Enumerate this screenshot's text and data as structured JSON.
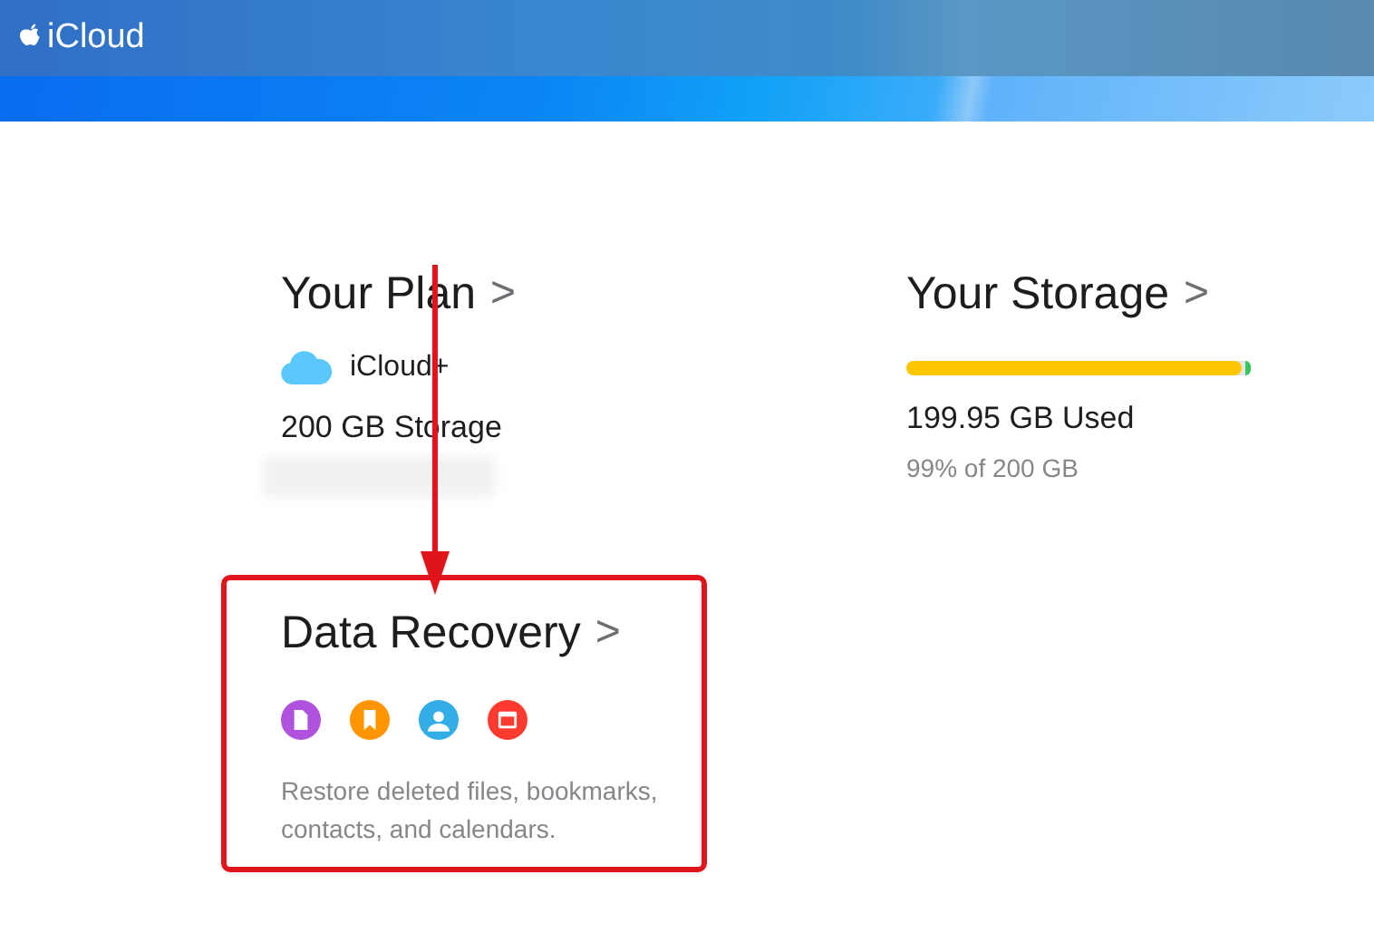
{
  "header": {
    "brand": "iCloud"
  },
  "plan": {
    "title": "Your Plan",
    "chevron": ">",
    "product": "iCloud+",
    "storage": "200 GB Storage"
  },
  "storage": {
    "title": "Your Storage",
    "chevron": ">",
    "level": 0.98,
    "used": "199.95 GB Used",
    "share": "99% of 200 GB"
  },
  "recovery": {
    "title": "Data Recovery",
    "chevron": ">",
    "highlighted": true,
    "apps": [
      {
        "kind": "file",
        "color": "#af52de"
      },
      {
        "kind": "bookmark",
        "color": "#ff9500"
      },
      {
        "kind": "contact",
        "color": "#32ade6"
      },
      {
        "kind": "calendar",
        "color": "#ff3b30"
      }
    ],
    "description": "Restore deleted files, bookmarks, contacts, and calendars."
  }
}
